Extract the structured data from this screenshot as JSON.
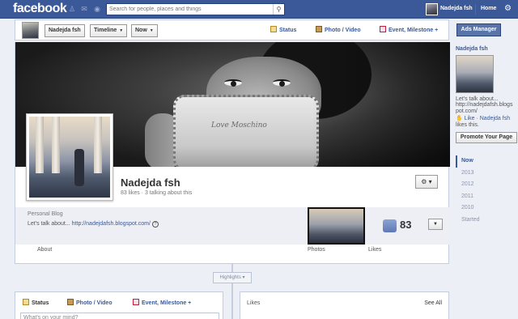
{
  "topbar": {
    "logo": "facebook",
    "search_placeholder": "Search for people, places and things",
    "user_name": "Nadejda fsh",
    "home_label": "Home"
  },
  "sticky_header": {
    "name_button": "Nadejda fsh",
    "timeline_button": "Timeline",
    "now_button": "Now",
    "composer": {
      "status": "Status",
      "photo_video": "Photo / Video",
      "event_milestone": "Event, Milestone +"
    }
  },
  "profile": {
    "name": "Nadejda fsh",
    "meta": "83 likes · 3 talking about this",
    "category": "Personal Blog",
    "about_prefix": "Let's talk about... ",
    "about_link": "http://nadejdafsh.blogspot.com/",
    "cover_text": "Love Moschino",
    "likes_count": "83",
    "tabs": {
      "about": "About",
      "photos": "Photos",
      "likes": "Likes"
    }
  },
  "timeline": {
    "highlights_label": "Highlights",
    "composer": {
      "status": "Status",
      "photo_video": "Photo / Video",
      "event_milestone": "Event, Milestone +",
      "input_placeholder": "What's on your mind?"
    },
    "likes_panel": {
      "title": "Likes",
      "see_all": "See All"
    }
  },
  "sidebar": {
    "ads_manager": "Ads Manager",
    "page_name": "Nadejda fsh",
    "desc_line1": "Let's talk about...",
    "desc_line2": "http://nadejdafsh.blogs",
    "desc_line3": "pot.com/",
    "like_link": "Like",
    "like_name": "· Nadejda fsh",
    "likes_this": "likes this.",
    "promote_button": "Promote Your Page",
    "years": [
      "Now",
      "2013",
      "2012",
      "2011",
      "2010",
      "Started"
    ]
  },
  "colors": {
    "brand_blue": "#3b5998",
    "background": "#eceff5"
  }
}
